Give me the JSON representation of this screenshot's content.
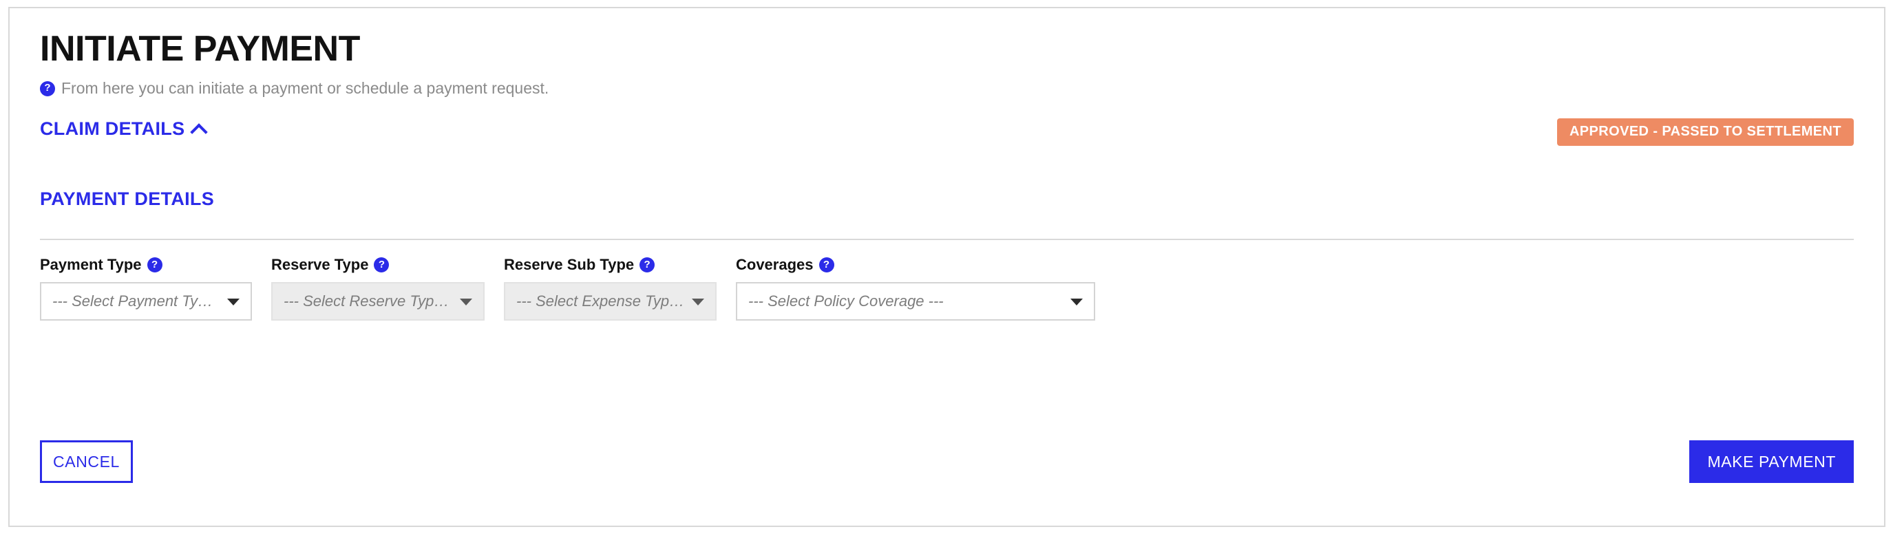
{
  "header": {
    "title": "INITIATE PAYMENT",
    "subtitle": "From here you can initiate a payment or schedule a payment request.",
    "subtitle_help_icon": "help-circle-icon",
    "help_glyph": "?"
  },
  "claim_details": {
    "label": "CLAIM DETAILS",
    "toggle_icon": "chevron-up-icon",
    "expanded": true,
    "status_badge": {
      "text": "APPROVED - PASSED TO SETTLEMENT",
      "background_color": "#EE8B63",
      "text_color": "#FFFFFF"
    }
  },
  "payment_details": {
    "section_title": "PAYMENT DETAILS",
    "fields": [
      {
        "label": "Payment Type",
        "help_icon": "help-circle-icon",
        "placeholder": "--- Select Payment Type ---",
        "value": "",
        "disabled": false,
        "caret_icon": "chevron-down-icon"
      },
      {
        "label": "Reserve Type",
        "help_icon": "help-circle-icon",
        "placeholder": "--- Select Reserve Type ---",
        "value": "",
        "disabled": true,
        "caret_icon": "chevron-down-icon"
      },
      {
        "label": "Reserve Sub Type",
        "help_icon": "help-circle-icon",
        "placeholder": "--- Select Expense Type ---",
        "value": "",
        "disabled": true,
        "caret_icon": "chevron-down-icon"
      },
      {
        "label": "Coverages",
        "help_icon": "help-circle-icon",
        "placeholder": "--- Select Policy Coverage ---",
        "value": "",
        "disabled": false,
        "caret_icon": "chevron-down-icon"
      }
    ]
  },
  "footer": {
    "cancel_label": "CANCEL",
    "make_payment_label": "MAKE PAYMENT"
  },
  "colors": {
    "brand_blue": "#2B2BE8",
    "status_orange": "#EE8B63",
    "muted_text": "#8A8A8A",
    "placeholder_text": "#7D7D7D",
    "border_gray": "#D4D4D4",
    "disabled_bg": "#ECECEC"
  }
}
